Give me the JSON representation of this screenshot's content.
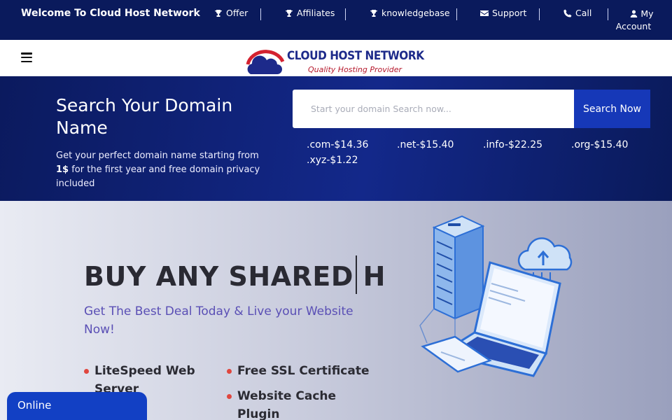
{
  "topbar": {
    "welcome": "Welcome To Cloud Host Network",
    "nav": [
      {
        "label": "Offer",
        "icon": "trophy-icon"
      },
      {
        "label": "Affiliates",
        "icon": "trophy-icon"
      },
      {
        "label": "knowledgebase",
        "icon": "trophy-icon"
      },
      {
        "label": "Support",
        "icon": "envelope-icon"
      },
      {
        "label": "Call",
        "icon": "phone-icon"
      },
      {
        "label": "My Account",
        "icon": "user-icon"
      }
    ]
  },
  "header": {
    "logo_text": "CLOUD HOST NETWORK",
    "logo_tagline": "Quality Hosting Provider"
  },
  "domain": {
    "title": "Search Your Domain Name",
    "subtitle_pre": "Get your perfect domain name starting from ",
    "subtitle_bold": "1$",
    "subtitle_post": " for the first year and free domain privacy included",
    "search_placeholder": "Start your domain Search now...",
    "search_button": "Search Now",
    "prices": [
      ".com-$14.36",
      ".net-$15.40",
      ".info-$22.25",
      ".org-$15.40",
      ".xyz-$1.22"
    ]
  },
  "hero": {
    "title": "BUY ANY SHARED H",
    "subtitle": "Get The Best Deal Today & Live your Website Now!",
    "features": [
      "LiteSpeed Web Server",
      "Free SSL Certificate",
      "Website Cache Plugin"
    ]
  },
  "chat": {
    "label": "Online"
  },
  "colors": {
    "topbar": "#0a1a5c",
    "search_button": "#1638b8",
    "accent_red": "#e0463e",
    "hero_subtitle": "#5a4fb5"
  }
}
